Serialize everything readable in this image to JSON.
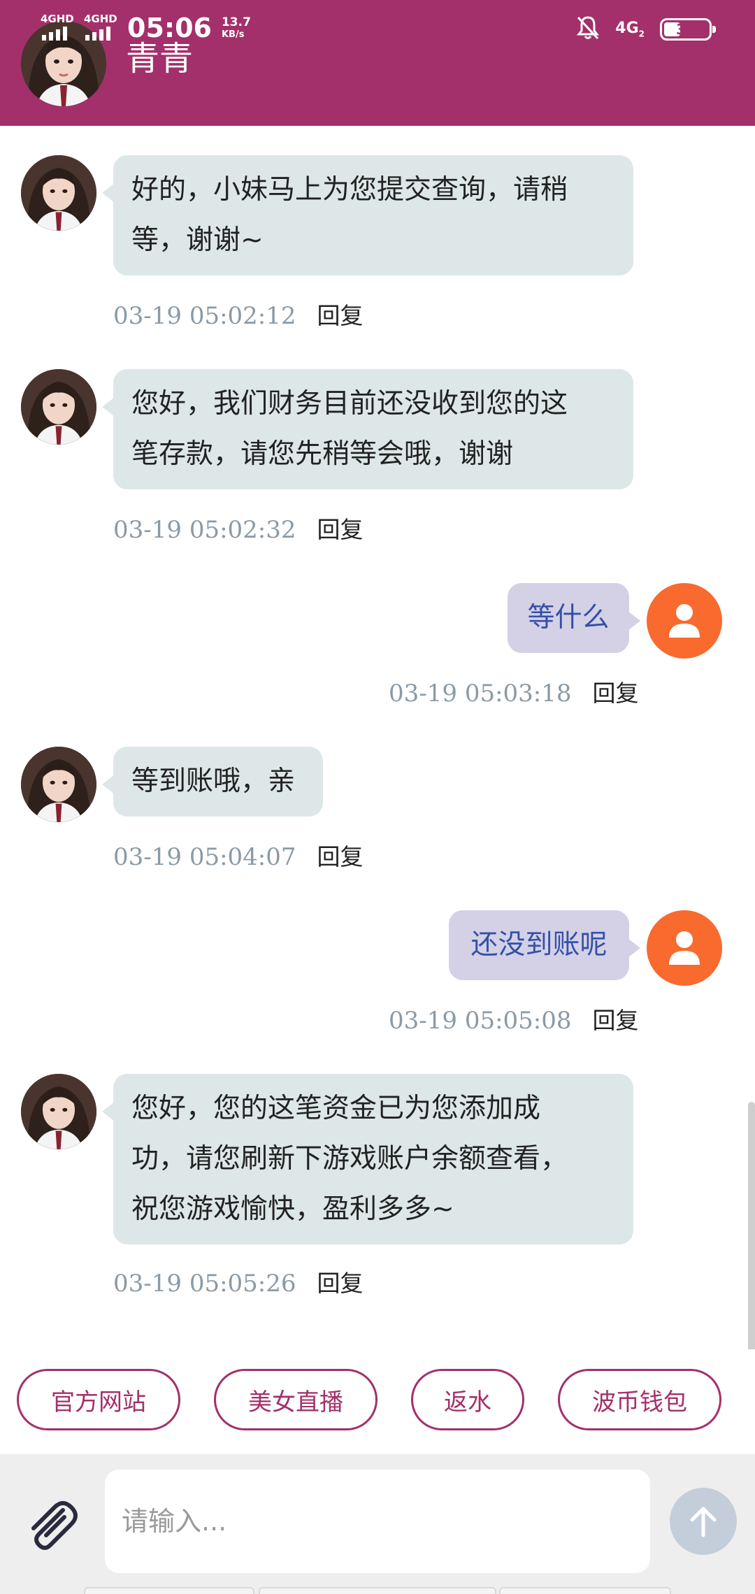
{
  "status_bar": {
    "network1": "4GHD",
    "network2": "4GHD",
    "time": "05:06",
    "speed_value": "13.7",
    "speed_unit": "KB/s",
    "network_type": "4G",
    "network_sub": "2",
    "battery": "34"
  },
  "header": {
    "contact_name": "青青"
  },
  "messages": [
    {
      "side": "agent",
      "text_lines": [
        "好的，小妹马上为您提交查询，请稍",
        "等，谢谢~"
      ],
      "time": "03-19 05:02:12",
      "reply": "回复"
    },
    {
      "side": "agent",
      "text_lines": [
        "您好，我们财务目前还没收到您的这",
        "笔存款，请您先稍等会哦，谢谢"
      ],
      "time": "03-19 05:02:32",
      "reply": "回复"
    },
    {
      "side": "user",
      "text_lines": [
        "等什么"
      ],
      "time": "03-19 05:03:18",
      "reply": "回复"
    },
    {
      "side": "agent",
      "text_lines": [
        "等到账哦，亲"
      ],
      "time": "03-19 05:04:07",
      "reply": "回复"
    },
    {
      "side": "user",
      "text_lines": [
        "还没到账呢"
      ],
      "time": "03-19 05:05:08",
      "reply": "回复"
    },
    {
      "side": "agent",
      "text_lines": [
        "您好，您的这笔资金已为您添加成",
        "功，请您刷新下游戏账户余额查看，",
        "祝您游戏愉快，盈利多多~"
      ],
      "time": "03-19 05:05:26",
      "reply": "回复"
    }
  ],
  "quick_links": [
    "官方网站",
    "美女直播",
    "返水",
    "波币钱包"
  ],
  "composer": {
    "placeholder": "请输入..."
  },
  "colors": {
    "header_bg": "#a3306a",
    "agent_bubble": "#dde7e8",
    "user_bubble": "#d4d1e6",
    "user_text": "#3550a8",
    "user_avatar": "#f96a2e",
    "time_text": "#8a9aa6",
    "send_button": "#c4cedb"
  },
  "icons": {
    "attach": "paperclip-icon",
    "send": "arrow-up-icon",
    "user_avatar": "person-icon",
    "mute": "bell-off-icon"
  }
}
